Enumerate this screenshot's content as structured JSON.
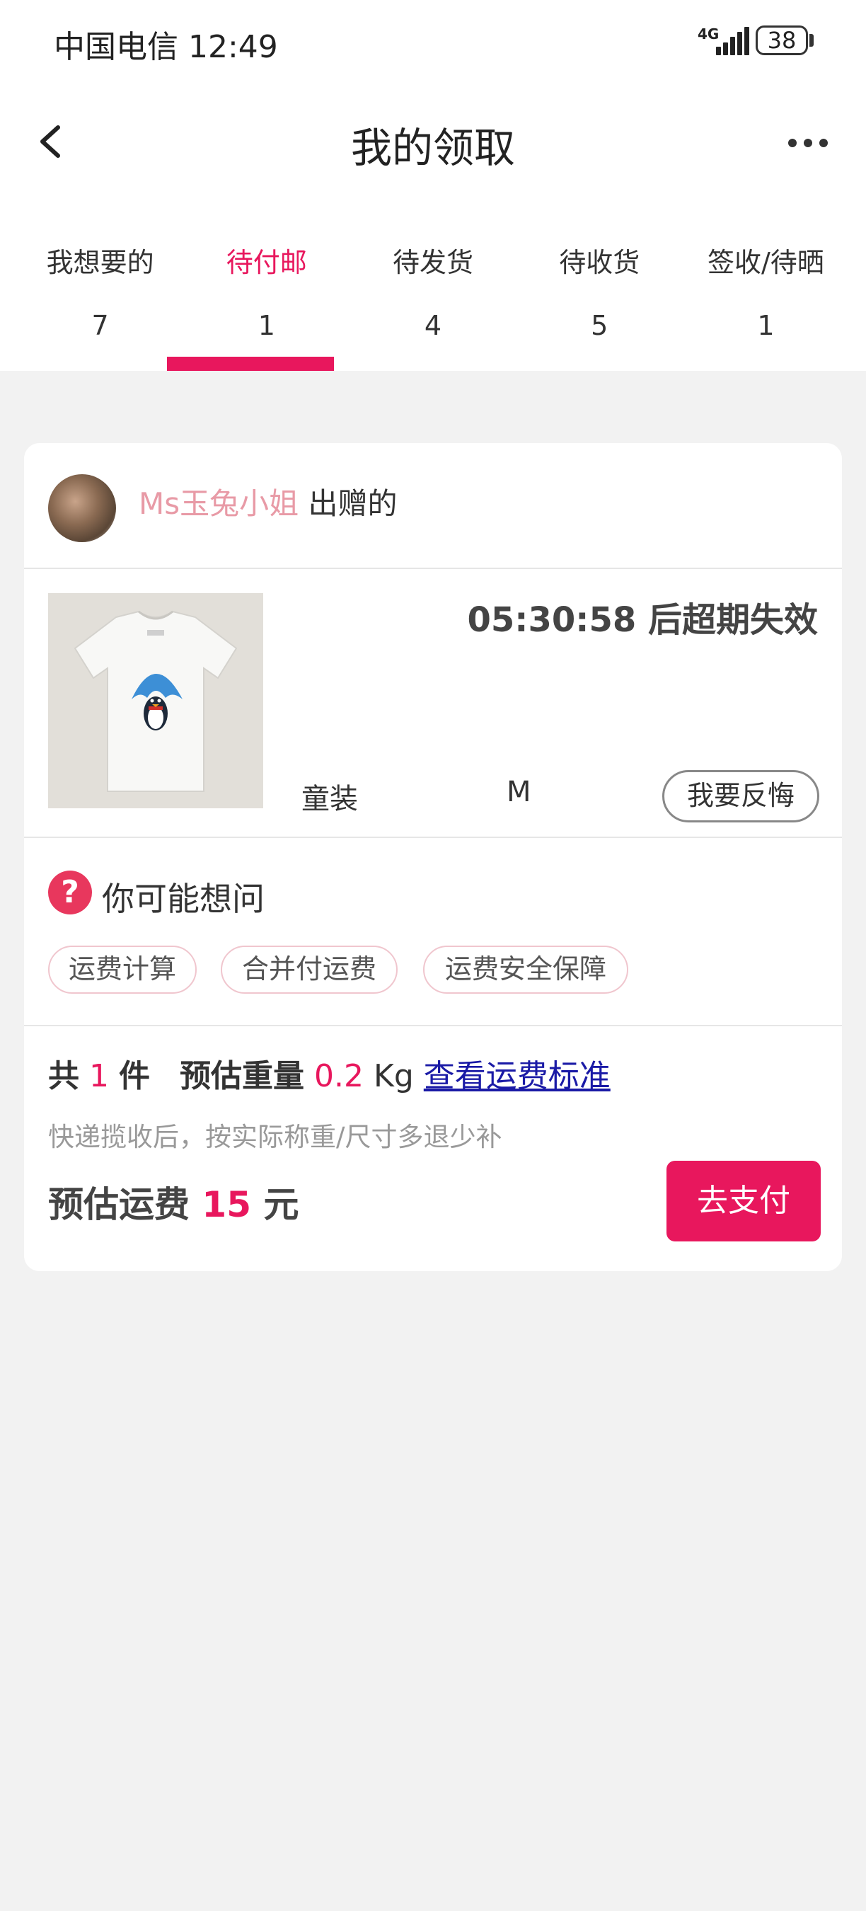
{
  "status_bar": {
    "carrier_time": "中国电信 12:49",
    "network": "4G",
    "battery": "38"
  },
  "header": {
    "title": "我的领取",
    "back_icon": "chevron-left-icon",
    "more_icon": "more-horizontal-icon"
  },
  "tabs": [
    {
      "label": "我想要的",
      "count": "7",
      "active": false
    },
    {
      "label": "待付邮",
      "count": "1",
      "active": true
    },
    {
      "label": "待发货",
      "count": "4",
      "active": false
    },
    {
      "label": "待收货",
      "count": "5",
      "active": false
    },
    {
      "label": "签收/待晒",
      "count": "1",
      "active": false
    }
  ],
  "order": {
    "seller_name": "Ms玉兔小姐",
    "seller_suffix": "出赠的",
    "countdown": "05:30:58 后超期失效",
    "category": "童装",
    "size": "M",
    "regret_button": "我要反悔",
    "faq": {
      "title": "你可能想问",
      "chips": [
        "运费计算",
        "合并付运费",
        "运费安全保障"
      ]
    },
    "summary": {
      "count_prefix": "共",
      "count_value": "1",
      "count_suffix": "件",
      "weight_label": "预估重量",
      "weight_value": "0.2",
      "weight_unit": "Kg",
      "standard_link": "查看运费标准"
    },
    "note": "快递揽收后，按实际称重/尺寸多退少补",
    "fee": {
      "label": "预估运费",
      "value": "15",
      "unit": "元"
    },
    "pay_button": "去支付"
  },
  "colors": {
    "accent": "#e8175d",
    "seller_name": "#e89aa6",
    "link": "#1a1aa6",
    "background": "#f2f2f2"
  }
}
